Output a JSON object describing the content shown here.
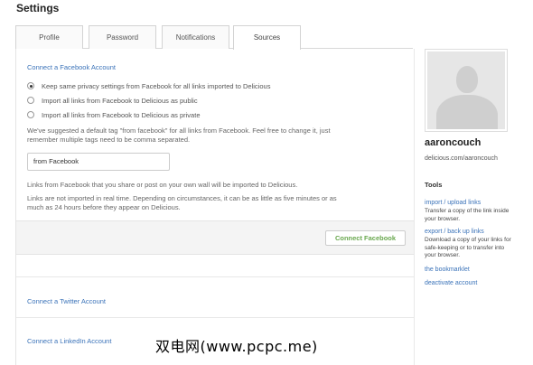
{
  "page": {
    "title": "Settings"
  },
  "tabs": [
    {
      "label": "Profile"
    },
    {
      "label": "Password"
    },
    {
      "label": "Notifications"
    },
    {
      "label": "Sources"
    }
  ],
  "facebook": {
    "heading": "Connect a Facebook Account",
    "options": [
      {
        "label": "Keep same privacy settings from Facebook for all links imported to Delicious",
        "checked": true
      },
      {
        "label": "Import all links from Facebook to Delicious as public",
        "checked": false
      },
      {
        "label": "Import all links from Facebook to Delicious as private",
        "checked": false
      }
    ],
    "tag_note": "We've suggested a default tag \"from facebook\" for all links from Facebook. Feel free to change it, just remember multiple tags need to be comma separated.",
    "tag_value": "from Facebook",
    "import_note": "Links from Facebook that you share or post on your own wall will be imported to Delicious.",
    "timing_note": "Links are not imported in real time. Depending on circumstances, it can be as little as five minutes or as much as 24 hours before they appear on Delicious.",
    "connect_label": "Connect Facebook"
  },
  "twitter": {
    "heading": "Connect a Twitter Account"
  },
  "linkedin": {
    "heading": "Connect a LinkedIn Account"
  },
  "sidebar": {
    "username": "aaroncouch",
    "profile_url": "delicious.com/aaroncouch",
    "tools_title": "Tools",
    "tools": [
      {
        "label": "import / upload links",
        "desc": "Transfer a copy of the link inside your browser."
      },
      {
        "label": "export / back up links",
        "desc": "Download a copy of your links for safe-keeping or to transfer into your browser."
      },
      {
        "label": "the bookmarklet",
        "desc": ""
      },
      {
        "label": "deactivate account",
        "desc": ""
      }
    ]
  },
  "watermark": "双电网(www.pcpc.me)",
  "colors": {
    "link": "#3b73b9",
    "connect_text": "#6aa84f"
  }
}
